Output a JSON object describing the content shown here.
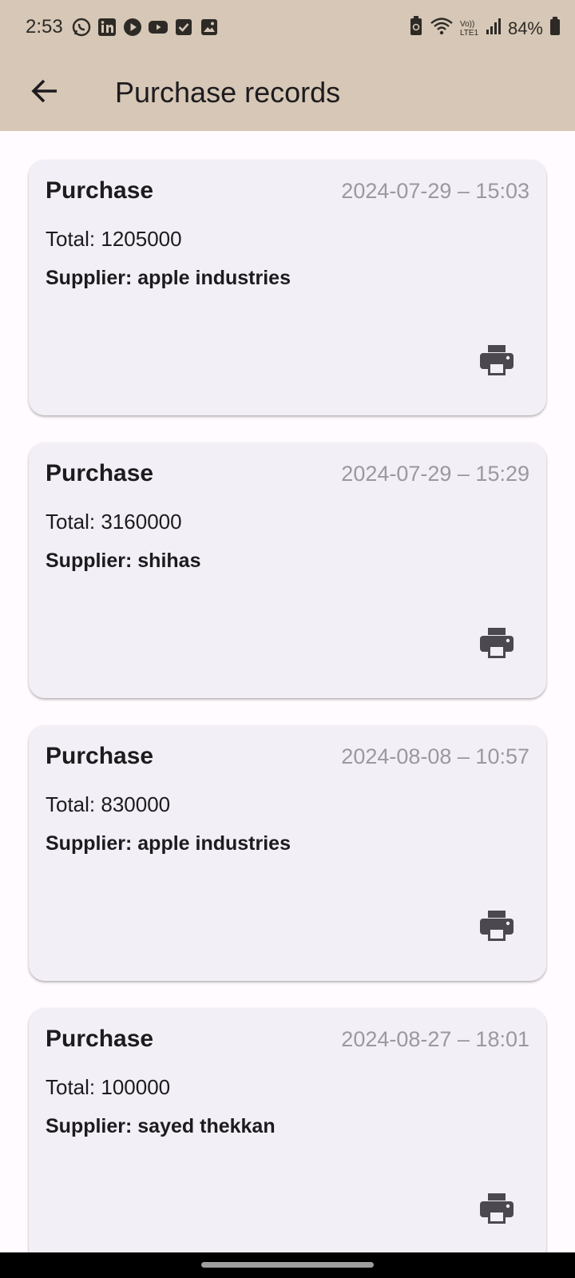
{
  "status_bar": {
    "time": "2:53",
    "battery": "84%",
    "notification_icons": [
      "whatsapp-icon",
      "linkedin-icon",
      "play-icon",
      "youtube-icon",
      "checkbox-icon",
      "image-icon"
    ],
    "system_icons": [
      "recycle-icon",
      "wifi-icon",
      "volte-icon",
      "signal-icon",
      "battery-icon"
    ],
    "volte_text": "Vo)) LTE1"
  },
  "app_bar": {
    "title": "Purchase records",
    "background": "#d6c7b6"
  },
  "records": [
    {
      "title": "Purchase",
      "datetime": "2024-07-29 – 15:03",
      "total": "Total: 1205000",
      "supplier": "Supplier: apple industries"
    },
    {
      "title": "Purchase",
      "datetime": "2024-07-29 – 15:29",
      "total": "Total: 3160000",
      "supplier": "Supplier: shihas"
    },
    {
      "title": "Purchase",
      "datetime": "2024-08-08 – 10:57",
      "total": "Total: 830000",
      "supplier": "Supplier: apple industries"
    },
    {
      "title": "Purchase",
      "datetime": "2024-08-27 – 18:01",
      "total": "Total: 100000",
      "supplier": "Supplier: sayed thekkan"
    }
  ],
  "colors": {
    "card_background": "#f3eff6",
    "date_text": "#9b989f",
    "page_background": "#fffbfe"
  }
}
